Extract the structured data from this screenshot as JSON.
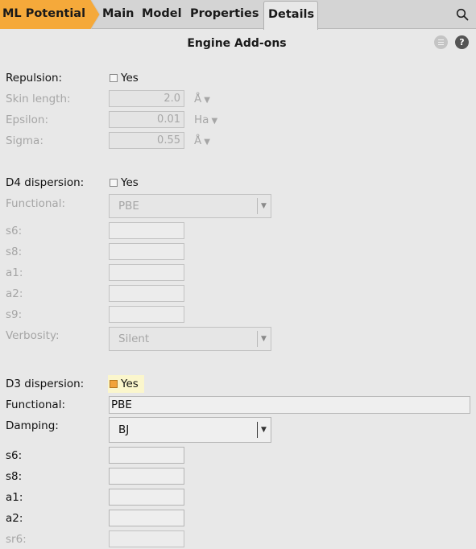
{
  "tabs": {
    "engine": "ML Potential",
    "main": "Main",
    "model": "Model",
    "properties": "Properties",
    "details": "Details"
  },
  "panel": {
    "title": "Engine Add-ons",
    "help_glyph": "?"
  },
  "repulsion": {
    "label": "Repulsion:",
    "checkbox_text": "Yes",
    "checked": false,
    "skin_length": {
      "label": "Skin length:",
      "value": "2.0",
      "unit": "Å"
    },
    "epsilon": {
      "label": "Epsilon:",
      "value": "0.01",
      "unit": "Ha"
    },
    "sigma": {
      "label": "Sigma:",
      "value": "0.55",
      "unit": "Å"
    }
  },
  "d4": {
    "label": "D4 dispersion:",
    "checkbox_text": "Yes",
    "checked": false,
    "functional": {
      "label": "Functional:",
      "value": "PBE"
    },
    "s6": {
      "label": "s6:",
      "value": ""
    },
    "s8": {
      "label": "s8:",
      "value": ""
    },
    "a1": {
      "label": "a1:",
      "value": ""
    },
    "a2": {
      "label": "a2:",
      "value": ""
    },
    "s9": {
      "label": "s9:",
      "value": ""
    },
    "verbosity": {
      "label": "Verbosity:",
      "value": "Silent"
    }
  },
  "d3": {
    "label": "D3 dispersion:",
    "checkbox_text": "Yes",
    "checked": true,
    "functional": {
      "label": "Functional:",
      "value": "PBE"
    },
    "damping": {
      "label": "Damping:",
      "value": "BJ"
    },
    "s6": {
      "label": "s6:",
      "value": ""
    },
    "s8": {
      "label": "s8:",
      "value": ""
    },
    "a1": {
      "label": "a1:",
      "value": ""
    },
    "a2": {
      "label": "a2:",
      "value": ""
    },
    "sr6": {
      "label": "sr6:",
      "value": ""
    }
  },
  "dropdown_arrow": "▼",
  "colors": {
    "accent": "#f5a93a",
    "highlight": "#fbf6cc"
  }
}
